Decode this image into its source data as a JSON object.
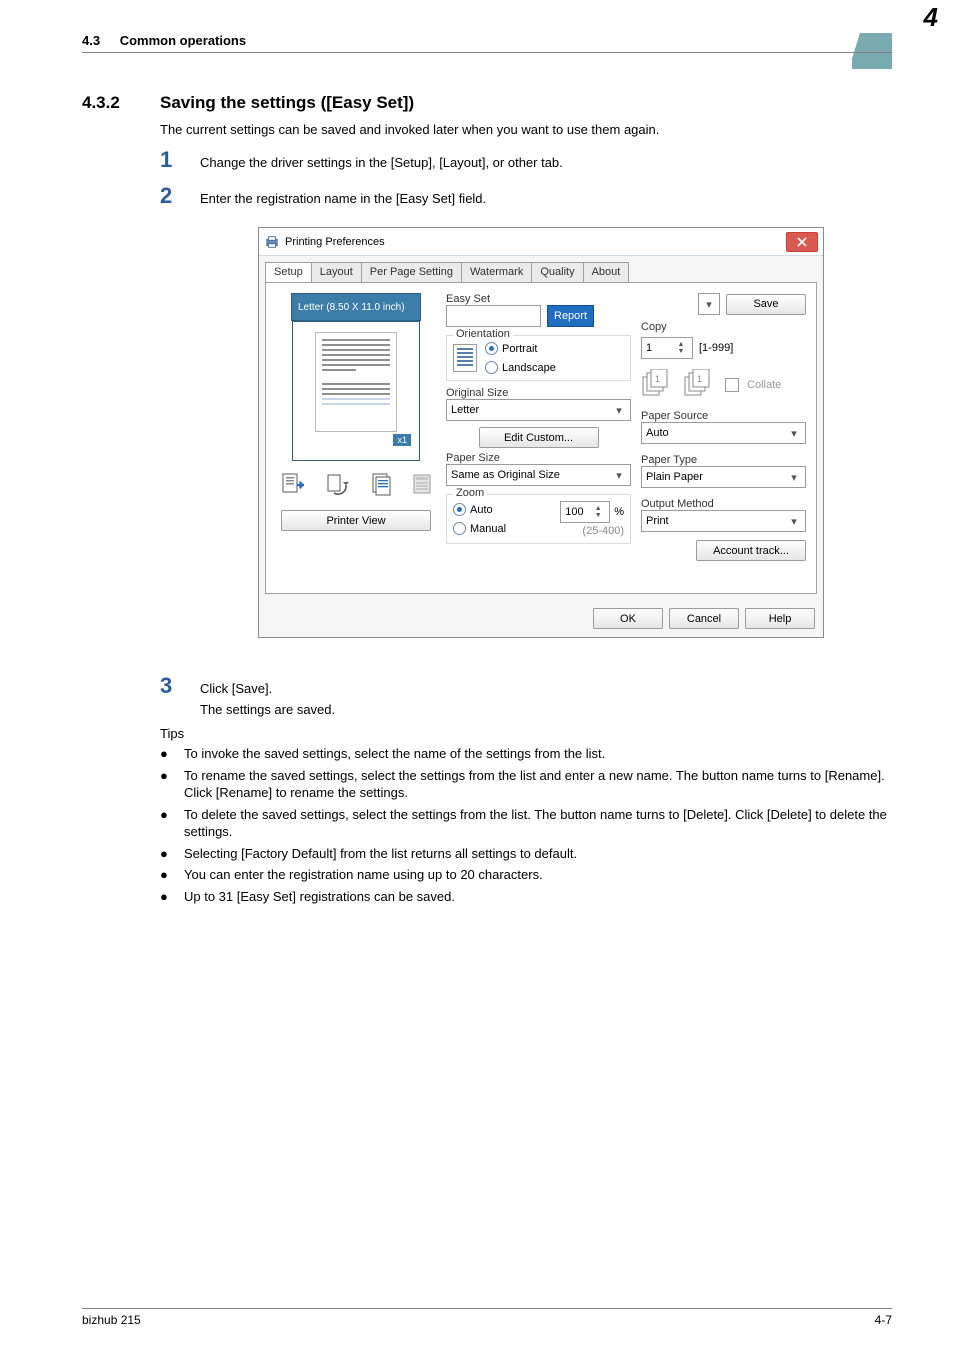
{
  "header": {
    "section_ref": "4.3",
    "section_name": "Common operations",
    "chapter_num": "4"
  },
  "section": {
    "num": "4.3.2",
    "title": "Saving the settings ([Easy Set])",
    "intro": "The current settings can be saved and invoked later when you want to use them again.",
    "steps": {
      "s1": "Change the driver settings in the [Setup], [Layout], or other tab.",
      "s2": "Enter the registration name in the [Easy Set] field.",
      "s3": "Click [Save].",
      "s3_sub": "The settings are saved."
    }
  },
  "tips_label": "Tips",
  "tips": [
    "To invoke the saved settings, select the name of the settings from the list.",
    "To rename the saved settings, select the settings from the list and enter a new name. The button name turns to [Rename]. Click [Rename] to rename the settings.",
    "To delete the saved settings, select the settings from the list. The button name turns to [Delete]. Click [Delete] to delete the settings.",
    "Selecting [Factory Default] from the list returns all settings to default.",
    "You can enter the registration name using up to 20 characters.",
    "Up to 31 [Easy Set] registrations can be saved."
  ],
  "dialog": {
    "title": "Printing Preferences",
    "tabs": [
      "Setup",
      "Layout",
      "Per Page Setting",
      "Watermark",
      "Quality",
      "About"
    ],
    "active_tab": 0,
    "left": {
      "paper_label": "Letter  (8.50 X 11.0 inch)",
      "scale_badge": "x1",
      "printer_view": "Printer View"
    },
    "mid": {
      "easy_set_label": "Easy Set",
      "easy_set_value": "",
      "report": "Report",
      "orientation_label": "Orientation",
      "portrait": "Portrait",
      "landscape": "Landscape",
      "original_size_label": "Original Size",
      "original_size_value": "Letter",
      "edit_custom": "Edit Custom...",
      "paper_size_label": "Paper Size",
      "paper_size_value": "Same as Original Size",
      "zoom_label": "Zoom",
      "zoom_auto": "Auto",
      "zoom_manual": "Manual",
      "zoom_value": "100",
      "zoom_unit": "%",
      "zoom_range": "(25-400)"
    },
    "right": {
      "save": "Save",
      "copy_label": "Copy",
      "copy_value": "1",
      "copy_range": "[1-999]",
      "collate": "Collate",
      "paper_source_label": "Paper Source",
      "paper_source_value": "Auto",
      "paper_type_label": "Paper Type",
      "paper_type_value": "Plain Paper",
      "output_method_label": "Output Method",
      "output_method_value": "Print",
      "account_track": "Account track..."
    },
    "buttons": {
      "ok": "OK",
      "cancel": "Cancel",
      "help": "Help"
    }
  },
  "footer": {
    "product": "bizhub 215",
    "pagenum": "4-7"
  },
  "icons": {
    "bullet": "●"
  }
}
